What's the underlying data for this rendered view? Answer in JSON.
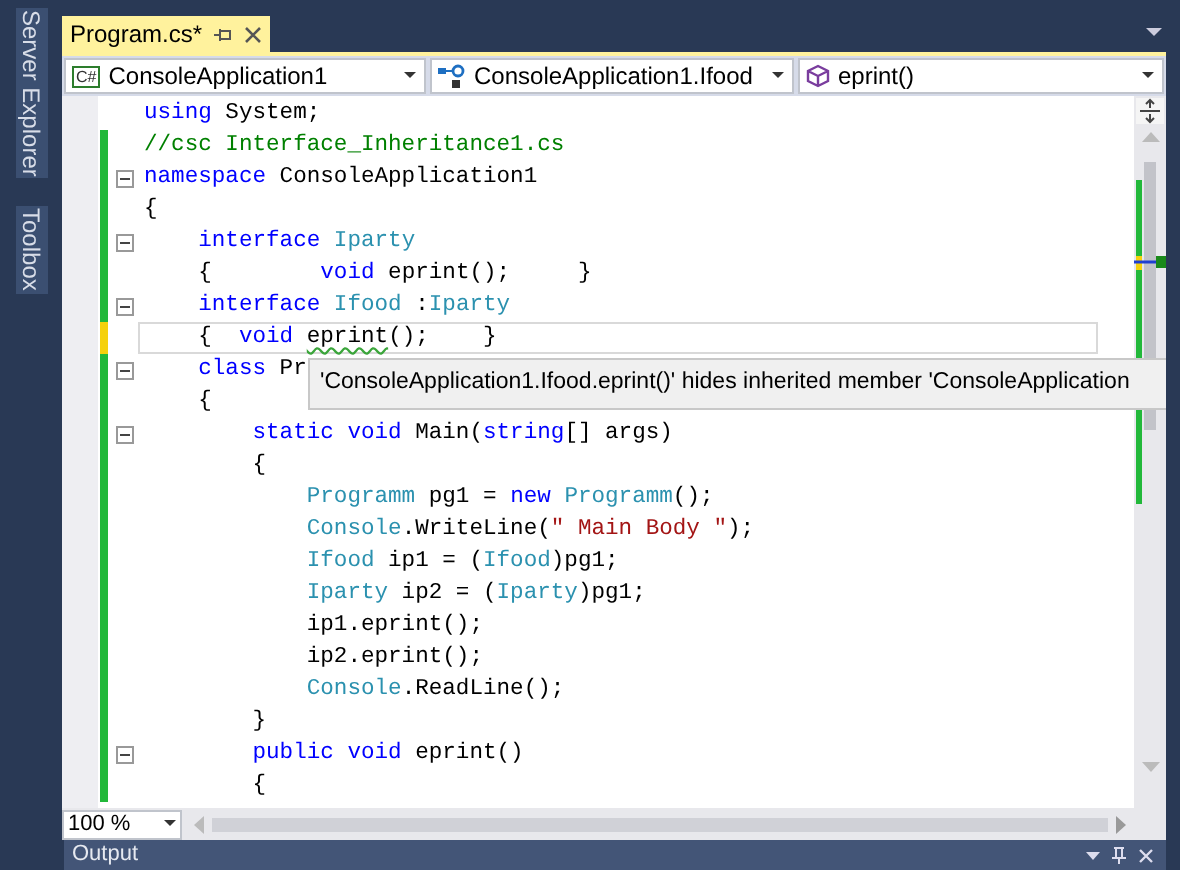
{
  "side_tabs": [
    {
      "label": "Server Explorer"
    },
    {
      "label": "Toolbox"
    }
  ],
  "document_tab": {
    "title": "Program.cs*",
    "selected": true
  },
  "nav_bar": [
    {
      "kind": "project",
      "badge": "C#",
      "label": "ConsoleApplication1"
    },
    {
      "kind": "type",
      "label": "ConsoleApplication1.Ifood"
    },
    {
      "kind": "member",
      "label": "eprint()"
    }
  ],
  "code_lines": [
    {
      "modified": false,
      "collapsible": false,
      "current": false,
      "tokens": [
        {
          "kind": "keyword",
          "text": "using"
        },
        {
          "kind": "plain",
          "text": " System;"
        }
      ]
    },
    {
      "modified": true,
      "saved": true,
      "collapsible": false,
      "current": false,
      "tokens": [
        {
          "kind": "comment",
          "text": "//csc Interface_Inheritance1.cs"
        }
      ]
    },
    {
      "modified": true,
      "saved": true,
      "collapsible": true,
      "current": false,
      "tokens": [
        {
          "kind": "keyword",
          "text": "namespace"
        },
        {
          "kind": "plain",
          "text": " ConsoleApplication1"
        }
      ]
    },
    {
      "modified": true,
      "saved": true,
      "collapsible": false,
      "current": false,
      "tokens": [
        {
          "kind": "plain",
          "text": "{"
        }
      ]
    },
    {
      "modified": true,
      "saved": true,
      "collapsible": true,
      "current": false,
      "tokens": [
        {
          "kind": "keyword",
          "text": "    interface "
        },
        {
          "kind": "type",
          "text": "Iparty"
        }
      ]
    },
    {
      "modified": true,
      "saved": true,
      "collapsible": false,
      "current": false,
      "tokens": [
        {
          "kind": "plain",
          "text": "    {        "
        },
        {
          "kind": "keyword",
          "text": "void"
        },
        {
          "kind": "plain",
          "text": " eprint();     }"
        }
      ]
    },
    {
      "modified": true,
      "saved": true,
      "collapsible": true,
      "current": false,
      "tokens": [
        {
          "kind": "keyword",
          "text": "    interface "
        },
        {
          "kind": "type",
          "text": "Ifood"
        },
        {
          "kind": "plain",
          "text": " :"
        },
        {
          "kind": "type",
          "text": "Iparty"
        }
      ]
    },
    {
      "modified": true,
      "saved": false,
      "collapsible": false,
      "current": true,
      "tokens": [
        {
          "kind": "plain",
          "text": "    {  "
        },
        {
          "kind": "keyword",
          "text": "void "
        },
        {
          "kind": "error",
          "text": "eprint"
        },
        {
          "kind": "plain",
          "text": "();    }"
        }
      ]
    },
    {
      "modified": true,
      "saved": true,
      "collapsible": true,
      "current": false,
      "tokens": [
        {
          "kind": "keyword",
          "text": "    class"
        },
        {
          "kind": "plain",
          "text": " Pr"
        }
      ]
    },
    {
      "modified": true,
      "saved": true,
      "collapsible": false,
      "current": false,
      "tokens": [
        {
          "kind": "plain",
          "text": "    {"
        }
      ]
    },
    {
      "modified": true,
      "saved": true,
      "collapsible": true,
      "current": false,
      "tokens": [
        {
          "kind": "keyword",
          "text": "        static void"
        },
        {
          "kind": "plain",
          "text": " Main("
        },
        {
          "kind": "keyword",
          "text": "string"
        },
        {
          "kind": "plain",
          "text": "[] args)"
        }
      ]
    },
    {
      "modified": true,
      "saved": true,
      "collapsible": false,
      "current": false,
      "tokens": [
        {
          "kind": "plain",
          "text": "        {"
        }
      ]
    },
    {
      "modified": true,
      "saved": true,
      "collapsible": false,
      "current": false,
      "tokens": [
        {
          "kind": "type",
          "text": "            Programm"
        },
        {
          "kind": "plain",
          "text": " pg1 = "
        },
        {
          "kind": "keyword",
          "text": "new "
        },
        {
          "kind": "type",
          "text": "Programm"
        },
        {
          "kind": "plain",
          "text": "();"
        }
      ]
    },
    {
      "modified": true,
      "saved": true,
      "collapsible": false,
      "current": false,
      "tokens": [
        {
          "kind": "type",
          "text": "            Console"
        },
        {
          "kind": "plain",
          "text": ".WriteLine("
        },
        {
          "kind": "string",
          "text": "\" Main Body \""
        },
        {
          "kind": "plain",
          "text": ");"
        }
      ]
    },
    {
      "modified": true,
      "saved": true,
      "collapsible": false,
      "current": false,
      "tokens": [
        {
          "kind": "type",
          "text": "            Ifood"
        },
        {
          "kind": "plain",
          "text": " ip1 = ("
        },
        {
          "kind": "type",
          "text": "Ifood"
        },
        {
          "kind": "plain",
          "text": ")pg1;"
        }
      ]
    },
    {
      "modified": true,
      "saved": true,
      "collapsible": false,
      "current": false,
      "tokens": [
        {
          "kind": "type",
          "text": "            Iparty"
        },
        {
          "kind": "plain",
          "text": " ip2 = ("
        },
        {
          "kind": "type",
          "text": "Iparty"
        },
        {
          "kind": "plain",
          "text": ")pg1;"
        }
      ]
    },
    {
      "modified": true,
      "saved": true,
      "collapsible": false,
      "current": false,
      "tokens": [
        {
          "kind": "plain",
          "text": "            ip1.eprint();"
        }
      ]
    },
    {
      "modified": true,
      "saved": true,
      "collapsible": false,
      "current": false,
      "tokens": [
        {
          "kind": "plain",
          "text": "            ip2.eprint();"
        }
      ]
    },
    {
      "modified": true,
      "saved": true,
      "collapsible": false,
      "current": false,
      "tokens": [
        {
          "kind": "type",
          "text": "            Console"
        },
        {
          "kind": "plain",
          "text": ".ReadLine();"
        }
      ]
    },
    {
      "modified": true,
      "saved": true,
      "collapsible": false,
      "current": false,
      "tokens": [
        {
          "kind": "plain",
          "text": "        }"
        }
      ]
    },
    {
      "modified": true,
      "saved": true,
      "collapsible": true,
      "current": false,
      "tokens": [
        {
          "kind": "keyword",
          "text": "        public void"
        },
        {
          "kind": "plain",
          "text": " eprint()"
        }
      ]
    },
    {
      "modified": true,
      "saved": true,
      "collapsible": false,
      "current": false,
      "tokens": [
        {
          "kind": "plain",
          "text": "        {"
        }
      ]
    }
  ],
  "tooltip": "'ConsoleApplication1.Ifood.eprint()' hides inherited member 'ConsoleApplication",
  "zoom": {
    "value": "100 %"
  },
  "output_panel": {
    "title": "Output"
  }
}
